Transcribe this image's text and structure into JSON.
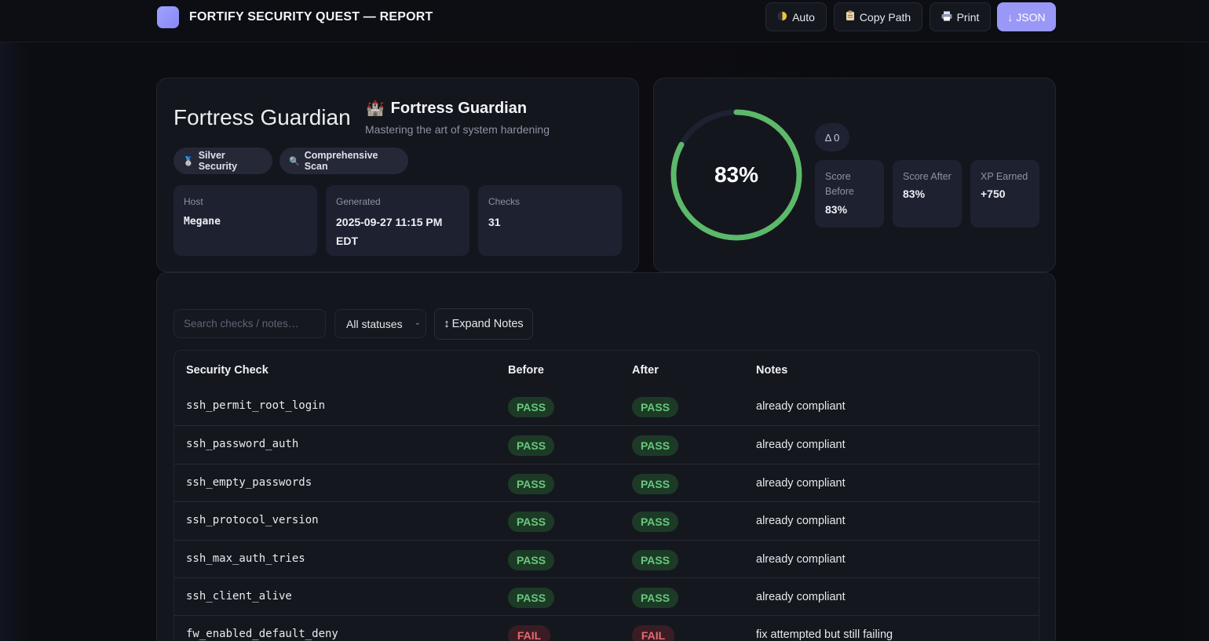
{
  "app": {
    "title": "FORTIFY SECURITY QUEST — REPORT",
    "buttons": {
      "theme": "Auto",
      "copy_path": "Copy Path",
      "print": "Print",
      "json": "↓ JSON"
    },
    "accent": "#9a98f6"
  },
  "profile": {
    "name": "Fortress Guardian",
    "rank_title": "Fortress Guardian",
    "rank_icon": "castle-icon",
    "rank_emoji": "🏰",
    "rank_subtitle": "Mastering the art of system hardening",
    "badges": [
      {
        "icon": "medal-icon",
        "emoji": "🥈",
        "label": "Silver Security"
      },
      {
        "icon": "magnifier-icon",
        "emoji": "🔍",
        "label": "Comprehensive Scan"
      }
    ],
    "info": [
      {
        "label": "Host",
        "value": "Megane"
      },
      {
        "label": "Generated",
        "value": "2025-09-27 11:15 PM EDT"
      },
      {
        "label": "Checks",
        "value": "31"
      }
    ]
  },
  "score": {
    "percent_value": 83,
    "percent_label": "83%",
    "ring_color": "#5cb96a",
    "delta": "Δ 0",
    "stats": [
      {
        "label": "Score Before",
        "value": "83%"
      },
      {
        "label": "Score After",
        "value": "83%"
      },
      {
        "label": "XP Earned",
        "value": "+750"
      }
    ]
  },
  "filters": {
    "search_placeholder": "Search checks / notes…",
    "status_selected": "All statuses",
    "expand_label": "Expand Notes"
  },
  "table": {
    "headers": [
      "Security Check",
      "Before",
      "After",
      "Notes"
    ],
    "rows": [
      {
        "check": "ssh_permit_root_login",
        "before": "PASS",
        "after": "PASS",
        "notes": "already compliant"
      },
      {
        "check": "ssh_password_auth",
        "before": "PASS",
        "after": "PASS",
        "notes": "already compliant"
      },
      {
        "check": "ssh_empty_passwords",
        "before": "PASS",
        "after": "PASS",
        "notes": "already compliant"
      },
      {
        "check": "ssh_protocol_version",
        "before": "PASS",
        "after": "PASS",
        "notes": "already compliant"
      },
      {
        "check": "ssh_max_auth_tries",
        "before": "PASS",
        "after": "PASS",
        "notes": "already compliant"
      },
      {
        "check": "ssh_client_alive",
        "before": "PASS",
        "after": "PASS",
        "notes": "already compliant"
      },
      {
        "check": "fw_enabled_default_deny",
        "before": "FAIL",
        "after": "FAIL",
        "notes": "fix attempted but still failing"
      }
    ]
  }
}
